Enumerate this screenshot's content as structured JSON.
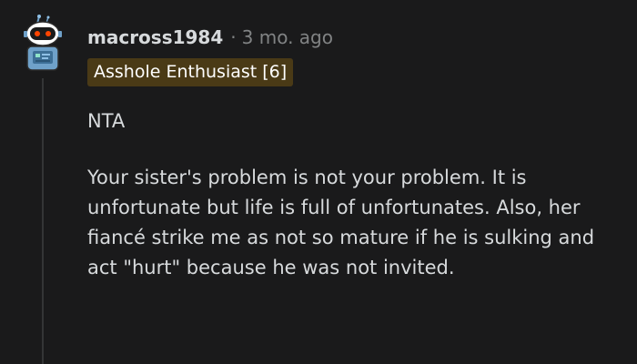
{
  "comment": {
    "author": "macross1984",
    "separator": "·",
    "timestamp": "3 mo. ago",
    "flair": "Asshole Enthusiast [6]",
    "paragraphs": [
      "NTA",
      "Your sister's problem is not your problem. It is unfortunate but life is full of unfortunates. Also, her fiancé strike me as not so mature if he is sulking and act \"hurt\" because he was not invited."
    ]
  },
  "colors": {
    "background": "#1a1a1b",
    "text": "#d7dadc",
    "meta": "#818384",
    "flair_background": "#4a3a16",
    "thread_line": "#343536"
  },
  "icons": {
    "avatar": "snoo-robot-avatar-icon"
  }
}
